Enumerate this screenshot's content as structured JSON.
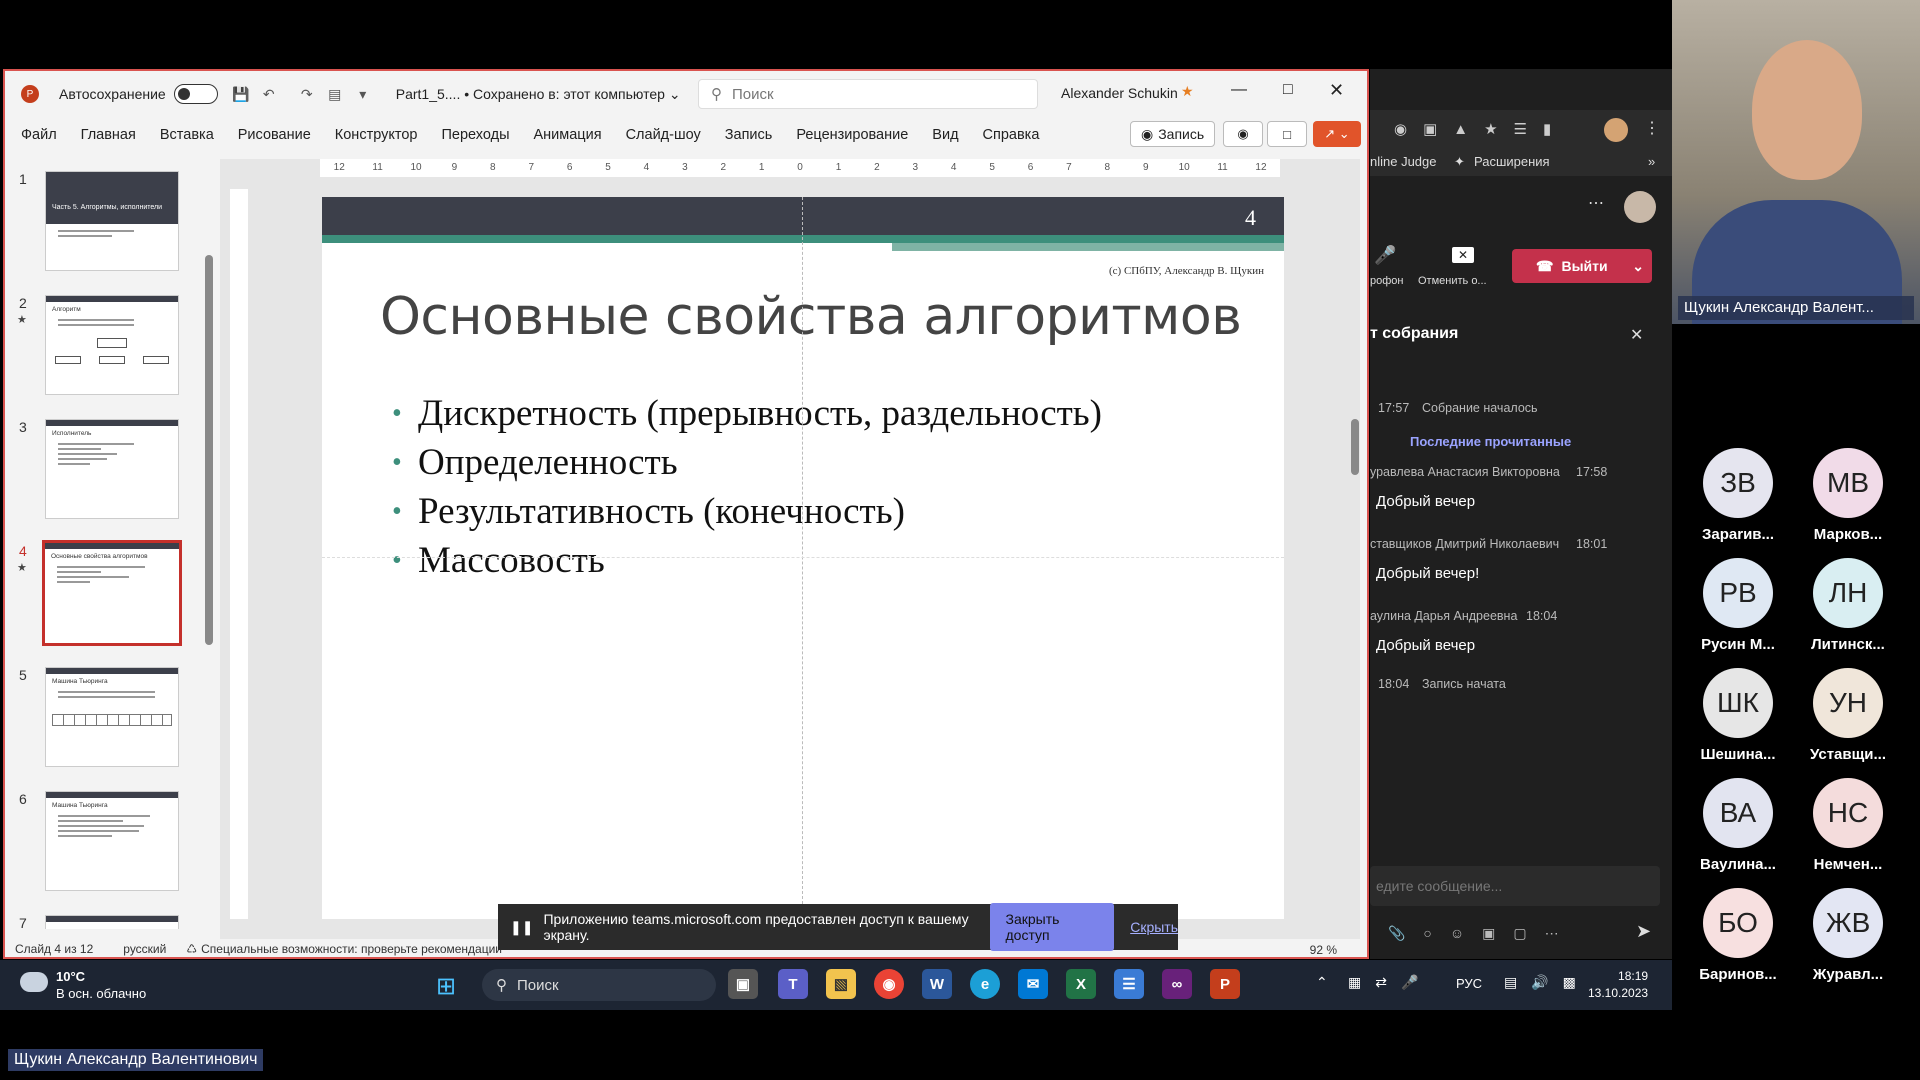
{
  "ppt": {
    "autosave_label": "Автосохранение",
    "file_title": "Part1_5.... • Сохранено в: этот компьютер",
    "search_placeholder": "Поиск",
    "user_name": "Alexander Schukin",
    "menu": [
      "Файл",
      "Главная",
      "Вставка",
      "Рисование",
      "Конструктор",
      "Переходы",
      "Анимация",
      "Слайд-шоу",
      "Запись",
      "Рецензирование",
      "Вид",
      "Справка"
    ],
    "record_button": "Запись",
    "ruler_marks": [
      "12",
      "11",
      "10",
      "9",
      "8",
      "7",
      "6",
      "5",
      "4",
      "3",
      "2",
      "1",
      "0",
      "1",
      "2",
      "3",
      "4",
      "5",
      "6",
      "7",
      "8",
      "9",
      "10",
      "11",
      "12"
    ],
    "thumbnails": [
      {
        "num": "1",
        "title": "Часть 5. Алгоритмы, исполнители",
        "star": false
      },
      {
        "num": "2",
        "title": "Алгоритм",
        "star": true
      },
      {
        "num": "3",
        "title": "Исполнитель",
        "star": false
      },
      {
        "num": "4",
        "title": "Основные свойства алгоритмов",
        "star": true
      },
      {
        "num": "5",
        "title": "Машина Тьюринга",
        "star": false
      },
      {
        "num": "6",
        "title": "Машина Тьюринга",
        "star": false
      },
      {
        "num": "7",
        "title": "",
        "star": false
      }
    ],
    "slide": {
      "number": "4",
      "copyright": "(с) СПбПУ, Александр В. Щукин",
      "title": "Основные свойства алгоритмов",
      "bullets": [
        "Дискретность (прерывность, раздельность)",
        "Определенность",
        "Результативность (конечность)",
        "Массовость"
      ]
    },
    "status": {
      "slide_count": "Слайд 4 из 12",
      "language": "русский",
      "accessibility": "Специальные возможности: проверьте рекомендации",
      "zoom": "92 %"
    }
  },
  "share_notification": {
    "text": "Приложению teams.microsoft.com предоставлен доступ к вашему экрану.",
    "close_button": "Закрыть доступ",
    "hide_link": "Скрыть"
  },
  "taskbar": {
    "temperature": "10°C",
    "weather": "В осн. облачно",
    "search": "Поиск",
    "language": "РУС",
    "time": "18:19",
    "date": "13.10.2023"
  },
  "teams": {
    "bookmark1": "nline Judge",
    "bookmark2": "Расширения",
    "mic_label": "рофон",
    "cancel_label": "Отменить о...",
    "leave_button": "Выйти",
    "chat_title": "т собрания",
    "meeting_started_time": "17:57",
    "meeting_started": "Собрание началось",
    "last_read": "Последние прочитанные",
    "messages": [
      {
        "author": "уравлева Анастасия Викторовна",
        "time": "17:58",
        "text": "Добрый вечер"
      },
      {
        "author": "ставщиков Дмитрий Николаевич",
        "time": "18:01",
        "text": "Добрый вечер!"
      },
      {
        "author": "аулина Дарья Андреевна",
        "time": "18:04",
        "text": "Добрый вечер"
      }
    ],
    "recording_time": "18:04",
    "recording_started": "Запись начата",
    "input_placeholder": "едите сообщение..."
  },
  "gallery": {
    "presenter": "Щукин Александр Валент...",
    "participants": [
      {
        "initials": "ЗВ",
        "name": "Заparив...",
        "color": "#e5e5ef"
      },
      {
        "initials": "МВ",
        "name": "Марков...",
        "color": "#f1dbe8"
      },
      {
        "initials": "РВ",
        "name": "Русин М...",
        "color": "#dfe8f3"
      },
      {
        "initials": "ЛН",
        "name": "Литинск...",
        "color": "#d9eef2"
      },
      {
        "initials": "ШК",
        "name": "Шешина...",
        "color": "#e6e6e6"
      },
      {
        "initials": "УН",
        "name": "Уставщи...",
        "color": "#f0e6da"
      },
      {
        "initials": "ВА",
        "name": "Ваулина...",
        "color": "#e2e4f0"
      },
      {
        "initials": "НС",
        "name": "Немчен...",
        "color": "#f4dcdc"
      },
      {
        "initials": "БО",
        "name": "Баринов...",
        "color": "#f7e0e0"
      },
      {
        "initials": "ЖВ",
        "name": "Журавл...",
        "color": "#e3e6f3"
      }
    ],
    "bottom_name": "Щукин Александр Валентинович"
  }
}
